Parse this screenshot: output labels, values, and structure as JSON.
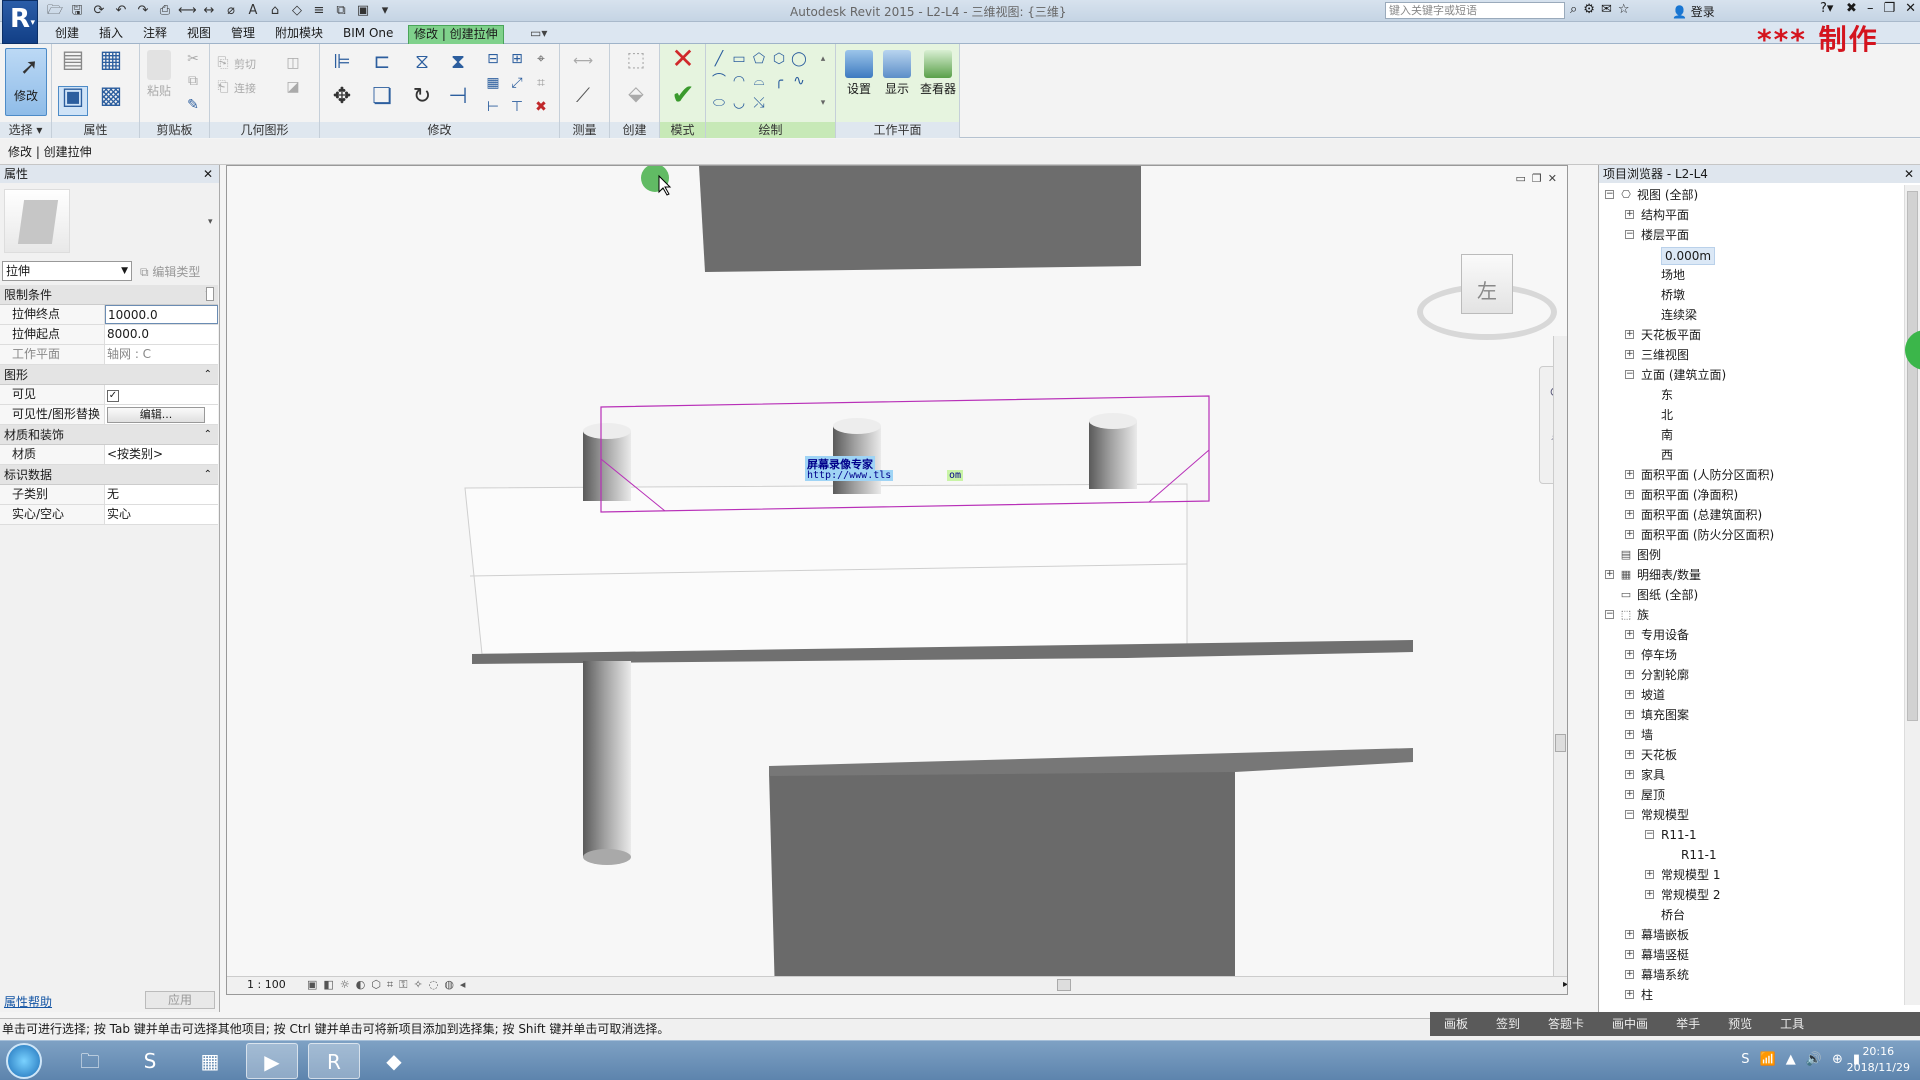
{
  "app": {
    "logo": "R",
    "window_title": "Autodesk Revit 2015 -    L2-L4 - 三维视图: {三维}",
    "search_placeholder": "键入关键字或短语",
    "login": "登录",
    "watermark": "*** 制作"
  },
  "ribbon": {
    "tabs": [
      "创建",
      "插入",
      "注释",
      "视图",
      "管理",
      "附加模块",
      "BIM One",
      "修改 | 创建拉伸"
    ],
    "active_tab_index": 7,
    "modify_label": "修改",
    "panels": [
      "选择",
      "属性",
      "剪贴板",
      "几何图形",
      "修改",
      "测量",
      "创建",
      "模式",
      "绘制",
      "工作平面"
    ],
    "select_dropdown": "选择 ▾",
    "paste_label": "粘贴",
    "cut_label": "剪切",
    "join_label": "连接",
    "workplane_buttons": [
      "设置",
      "显示",
      "查看器"
    ]
  },
  "options_bar": {
    "context": "修改 | 创建拉伸"
  },
  "properties": {
    "title": "属性",
    "type_name": "拉伸",
    "edit_type": "编辑类型",
    "sections": [
      {
        "name": "限制条件",
        "rows": [
          {
            "key": "拉伸终点",
            "value": "10000.0"
          },
          {
            "key": "拉伸起点",
            "value": "8000.0"
          },
          {
            "key": "工作平面",
            "value": "轴网 : C"
          }
        ]
      },
      {
        "name": "图形",
        "rows": [
          {
            "key": "可见",
            "value": "✓"
          },
          {
            "key": "可见性/图形替换",
            "value": "编辑..."
          }
        ]
      },
      {
        "name": "材质和装饰",
        "rows": [
          {
            "key": "材质",
            "value": "<按类别>"
          }
        ]
      },
      {
        "name": "标识数据",
        "rows": [
          {
            "key": "子类别",
            "value": "无"
          },
          {
            "key": "实心/空心",
            "value": "实心"
          }
        ]
      }
    ],
    "help_link": "属性帮助",
    "apply": "应用"
  },
  "viewport": {
    "viewcube_face": "左",
    "scale": "1 : 100",
    "overlay_text_1": "屏幕录像专家",
    "overlay_text_2": "http://www.tls",
    "overlay_text_3": "om"
  },
  "browser": {
    "title": "项目浏览器 - L2-L4",
    "nodes": [
      {
        "level": 0,
        "toggle": "-",
        "icon": "views",
        "label": "视图 (全部)"
      },
      {
        "level": 1,
        "toggle": "+",
        "label": "结构平面"
      },
      {
        "level": 1,
        "toggle": "-",
        "label": "楼层平面"
      },
      {
        "level": 2,
        "toggle": "",
        "label": "0.000m",
        "selected": true
      },
      {
        "level": 2,
        "toggle": "",
        "label": "场地"
      },
      {
        "level": 2,
        "toggle": "",
        "label": "桥墩"
      },
      {
        "level": 2,
        "toggle": "",
        "label": "连续梁"
      },
      {
        "level": 1,
        "toggle": "+",
        "label": "天花板平面"
      },
      {
        "level": 1,
        "toggle": "+",
        "label": "三维视图"
      },
      {
        "level": 1,
        "toggle": "-",
        "label": "立面 (建筑立面)"
      },
      {
        "level": 2,
        "toggle": "",
        "label": "东"
      },
      {
        "level": 2,
        "toggle": "",
        "label": "北"
      },
      {
        "level": 2,
        "toggle": "",
        "label": "南"
      },
      {
        "level": 2,
        "toggle": "",
        "label": "西"
      },
      {
        "level": 1,
        "toggle": "+",
        "label": "面积平面 (人防分区面积)"
      },
      {
        "level": 1,
        "toggle": "+",
        "label": "面积平面 (净面积)"
      },
      {
        "level": 1,
        "toggle": "+",
        "label": "面积平面 (总建筑面积)"
      },
      {
        "level": 1,
        "toggle": "+",
        "label": "面积平面 (防火分区面积)"
      },
      {
        "level": 0,
        "toggle": "",
        "icon": "legend",
        "label": "图例"
      },
      {
        "level": 0,
        "toggle": "+",
        "icon": "schedule",
        "label": "明细表/数量"
      },
      {
        "level": 0,
        "toggle": "",
        "icon": "sheet",
        "label": "图纸 (全部)"
      },
      {
        "level": 0,
        "toggle": "-",
        "icon": "family",
        "label": "族"
      },
      {
        "level": 1,
        "toggle": "+",
        "label": "专用设备"
      },
      {
        "level": 1,
        "toggle": "+",
        "label": "停车场"
      },
      {
        "level": 1,
        "toggle": "+",
        "label": "分割轮廓"
      },
      {
        "level": 1,
        "toggle": "+",
        "label": "坡道"
      },
      {
        "level": 1,
        "toggle": "+",
        "label": "填充图案"
      },
      {
        "level": 1,
        "toggle": "+",
        "label": "墙"
      },
      {
        "level": 1,
        "toggle": "+",
        "label": "天花板"
      },
      {
        "level": 1,
        "toggle": "+",
        "label": "家具"
      },
      {
        "level": 1,
        "toggle": "+",
        "label": "屋顶"
      },
      {
        "level": 1,
        "toggle": "-",
        "label": "常规模型"
      },
      {
        "level": 2,
        "toggle": "-",
        "label": "R11-1"
      },
      {
        "level": 3,
        "toggle": "",
        "label": "R11-1"
      },
      {
        "level": 2,
        "toggle": "+",
        "label": "常规模型 1"
      },
      {
        "level": 2,
        "toggle": "+",
        "label": "常规模型 2"
      },
      {
        "level": 2,
        "toggle": "",
        "label": "桥台"
      },
      {
        "level": 1,
        "toggle": "+",
        "label": "幕墙嵌板"
      },
      {
        "level": 1,
        "toggle": "+",
        "label": "幕墙竖梃"
      },
      {
        "level": 1,
        "toggle": "+",
        "label": "幕墙系统"
      },
      {
        "level": 1,
        "toggle": "+",
        "label": "柱"
      }
    ]
  },
  "status": {
    "text": "单击可进行选择; 按 Tab 键并单击可选择其他项目; 按 Ctrl 键并单击可将新项目添加到选择集; 按 Shift 键并单击可取消选择。"
  },
  "recorder_bar": [
    "画板",
    "签到",
    "答题卡",
    "画中画",
    "举手",
    "预览",
    "工具"
  ],
  "taskbar": {
    "time": "20:16",
    "date": "2018/11/29"
  }
}
